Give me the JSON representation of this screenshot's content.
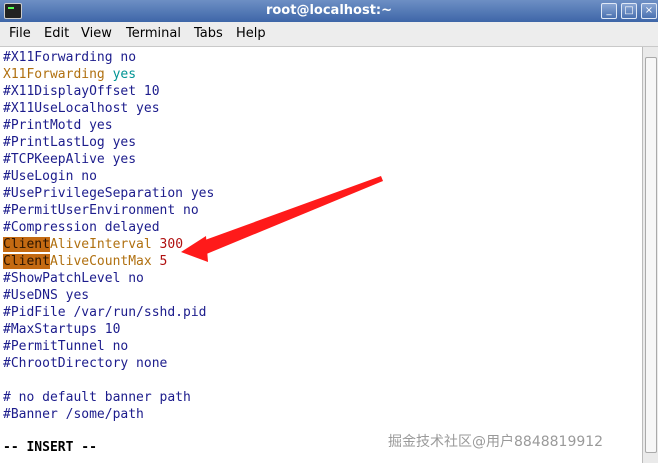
{
  "window": {
    "title": "root@localhost:~",
    "buttons": {
      "minimize": "_",
      "maximize": "□",
      "close": "×"
    }
  },
  "menu": {
    "items": [
      "File",
      "Edit",
      "View",
      "Terminal",
      "Tabs",
      "Help"
    ]
  },
  "terminal": {
    "lines": [
      "#X11Forwarding no",
      "X11Forwarding yes",
      "#X11DisplayOffset 10",
      "#X11UseLocalhost yes",
      "#PrintMotd yes",
      "#PrintLastLog yes",
      "#TCPKeepAlive yes",
      "#UseLogin no",
      "#UsePrivilegeSeparation yes",
      "#PermitUserEnvironment no",
      "#Compression delayed",
      "ClientAliveInterval 300",
      "ClientAliveCountMax 5",
      "#ShowPatchLevel no",
      "#UseDNS yes",
      "#PidFile /var/run/sshd.pid",
      "#MaxStartups 10",
      "#PermitTunnel no",
      "#ChrootDirectory none",
      "",
      "# no default banner path",
      "#Banner /some/path"
    ],
    "status": "-- INSERT --"
  },
  "watermark": {
    "text": "掘金技术社区@用户8848819912"
  },
  "colors": {
    "highlight": "#c46a12",
    "arrow": "#ff1a1a",
    "keyword": "#b07010",
    "comment": "#1c1c8c"
  }
}
